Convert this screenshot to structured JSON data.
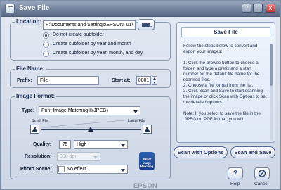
{
  "window": {
    "title": "Save File",
    "title_buttons": [
      "?",
      "_",
      "x"
    ]
  },
  "location": {
    "group_label": "Location:",
    "path": "F:\\Documents and Settings\\EPSON_01\\",
    "browse_icon": "folder-icon",
    "options": [
      {
        "label": "Do not create subfolder",
        "selected": true
      },
      {
        "label": "Create subfolder by year and month",
        "selected": false
      },
      {
        "label": "Create subfolder by year, month, and day",
        "selected": false
      }
    ]
  },
  "file_name": {
    "group_label": "File Name:",
    "prefix_label": "Prefix:",
    "prefix_value": "File",
    "start_label": "Start at:",
    "start_value": "0001"
  },
  "image_format": {
    "group_label": "Image Format:",
    "type_label": "Type:",
    "type_value": "Print Image Matching II(JPEG)",
    "small_label": "Small File",
    "large_label": "Large File",
    "quality_label": "Quality:",
    "quality_number": "75",
    "quality_level": "High",
    "resolution_label": "Resolution:",
    "resolution_value": "300 dpi",
    "photo_scene_label": "Photo Scene:",
    "photo_scene_value": "No effect",
    "badge_text": "PRINT Image Matching"
  },
  "help_panel": {
    "title": "Save File",
    "text": "Follow the steps below to convert and export your images:\n\n1. Click the browse button to choose a folder, and type a prefix and a start number for the default file name for the scanned files.\n2. Choose a file format from the list.\n3. Click Scan and Save to start scanning the image or click Scan with Options to set the detailed options.\n\nNote: If you select to save the file in the .JPEG or .PDF format, you will"
  },
  "buttons": {
    "scan_with_options": "Scan with Options",
    "scan_and_save": "Scan and Save",
    "help": "Help",
    "cancel": "Cancel"
  },
  "brand": "EPSON",
  "colors": {
    "accent": "#1b2f56",
    "title_gradient_top": "#9aa9bf",
    "badge": "#1c3f86"
  }
}
